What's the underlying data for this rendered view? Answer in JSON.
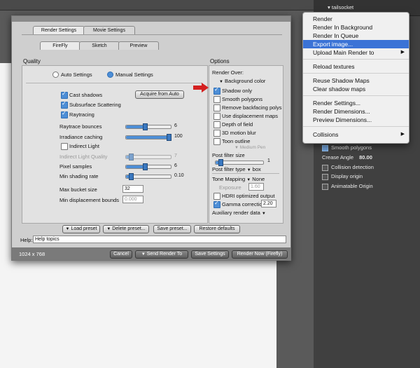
{
  "background": {
    "right_panel_title": "tailsocket",
    "panel_items": [
      {
        "label": "Smooth polygons",
        "checked": true
      },
      {
        "label": "Crease Angle",
        "value": "80.00"
      },
      {
        "label": "Collision detection",
        "checked": false
      },
      {
        "label": "Display origin",
        "checked": false
      },
      {
        "label": "Animatable Origin",
        "checked": false
      }
    ]
  },
  "dialog": {
    "top_tabs": [
      "Render Settings",
      "Movie Settings"
    ],
    "sub_tabs": [
      "FireFly",
      "Sketch",
      "Preview"
    ],
    "quality": {
      "heading": "Quality",
      "auto_label": "Auto Settings",
      "manual_label": "Manual Settings",
      "cast_shadows": "Cast shadows",
      "subsurface": "Subsurface Scattering",
      "raytracing": "Raytracing",
      "acquire_button": "Acquire from Auto",
      "raytrace_bounces": {
        "label": "Raytrace bounces",
        "value": "6"
      },
      "irradiance_caching": {
        "label": "Irradiance caching",
        "value": "100"
      },
      "indirect_light": "Indirect Light",
      "indirect_quality": {
        "label": "Indirect Light Quality",
        "value": "7"
      },
      "pixel_samples": {
        "label": "Pixel samples",
        "value": "6"
      },
      "min_shading_rate": {
        "label": "Min shading rate",
        "value": "0.10"
      },
      "max_bucket_size": {
        "label": "Max bucket size",
        "value": "32"
      },
      "min_displacement": {
        "label": "Min displacement bounds",
        "value": "0.000"
      }
    },
    "options": {
      "heading": "Options",
      "render_over": "Render Over:",
      "background_color": "Background color",
      "shadow_only": "Shadow only",
      "smooth_polygons": "Smooth polygons",
      "remove_backfacing": "Remove backfacing polys",
      "use_displacement": "Use displacement maps",
      "depth_of_field": "Depth of field",
      "motion_blur": "3D motion blur",
      "toon_outline": "Toon outline",
      "medium_pen": "Medium Pen",
      "post_filter_size": {
        "label": "Post filter size",
        "value": "1"
      },
      "post_filter_type": {
        "label": "Post filter type",
        "value": "box"
      },
      "tone_mapping": {
        "label": "Tone Mapping",
        "value": "None"
      },
      "exposure": {
        "label": "Exposure",
        "value": "1.60"
      },
      "hdri": "HDRI optimized output",
      "gamma": {
        "label": "Gamma correction",
        "value": "2.20"
      },
      "aux": "Auxiliary render data"
    },
    "preset_buttons": [
      "Load preset",
      "Delete preset...",
      "Save preset...",
      "Restore defaults"
    ],
    "help": {
      "label": "Help:",
      "value": "Help topics"
    },
    "footer": {
      "size": "1024 x 768",
      "cancel": "Cancel",
      "send_render": "Send Render To",
      "save_settings": "Save Settings",
      "render_now": "Render Now (Firefly)"
    }
  },
  "context_menu": {
    "items": [
      {
        "label": "Render"
      },
      {
        "label": "Render In Background"
      },
      {
        "label": "Render In Queue"
      },
      {
        "label": "Export image...",
        "selected": true
      },
      {
        "label": "Upload Main Render to",
        "submenu": true
      },
      {
        "label": "Reload textures"
      },
      {
        "label": "Reuse Shadow Maps"
      },
      {
        "label": "Clear shadow maps"
      },
      {
        "label": "Render Settings..."
      },
      {
        "label": "Render Dimensions..."
      },
      {
        "label": "Preview Dimensions..."
      },
      {
        "label": "Collisions",
        "submenu": true
      }
    ]
  },
  "colors": {
    "highlight": "#3b73d6",
    "arrow": "#d42020",
    "check": "#4d8ed6"
  }
}
